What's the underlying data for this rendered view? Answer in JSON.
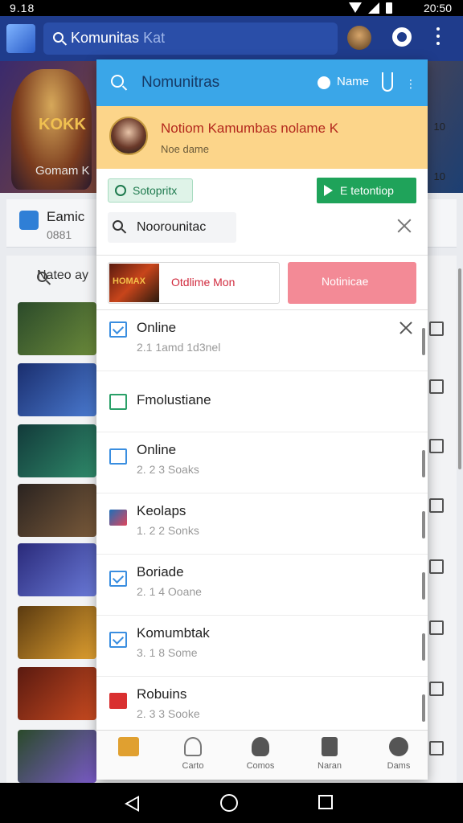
{
  "status_bar": {
    "left": "9.18",
    "time": "20:50"
  },
  "header": {
    "search_value": "Komunitas",
    "search_hint": "Kat"
  },
  "background": {
    "hero_title": "KOKK",
    "hero_sub": "Gomam K",
    "hero_num1": "10",
    "hero_num2": "10",
    "card_title": "Eamic",
    "card_sub": "0881",
    "list_search": "Nateo ay"
  },
  "panel": {
    "header_title": "Nomunitras",
    "header_name": "Name",
    "banner_title": "Notiom Kamumbas nolame K",
    "banner_sub": "Noe dame",
    "chip_label": "Sotopritx",
    "green_button": "E tetontiop",
    "search_value": "Noorounitac",
    "tab_image_text": "HOMAX",
    "tab_left_label": "Otdlime Mon",
    "tab_right_label": "Notinicae",
    "rows": [
      {
        "title": "Online",
        "sub": "2.1 1amd 1d3nel"
      },
      {
        "title": "Fmolustiane",
        "sub": ""
      },
      {
        "title": "Online",
        "sub": "2. 2 3 Soaks"
      },
      {
        "title": "Keolaps",
        "sub": "1. 2 2 Sonks"
      },
      {
        "title": "Boriade",
        "sub": "2. 1 4 Ooane"
      },
      {
        "title": "Komumbtak",
        "sub": "3. 1 8 Some"
      },
      {
        "title": "Robuins",
        "sub": "2. 3 3 Sooke"
      }
    ],
    "nav": [
      {
        "label": ""
      },
      {
        "label": "Carto"
      },
      {
        "label": "Comos"
      },
      {
        "label": "Naran"
      },
      {
        "label": "Dams"
      }
    ]
  },
  "colors": {
    "header_blue": "#1f3c8c",
    "panel_head": "#3aa6e8",
    "banner": "#fcd58a",
    "accent_green": "#1fa35a",
    "accent_pink": "#f38a96"
  }
}
